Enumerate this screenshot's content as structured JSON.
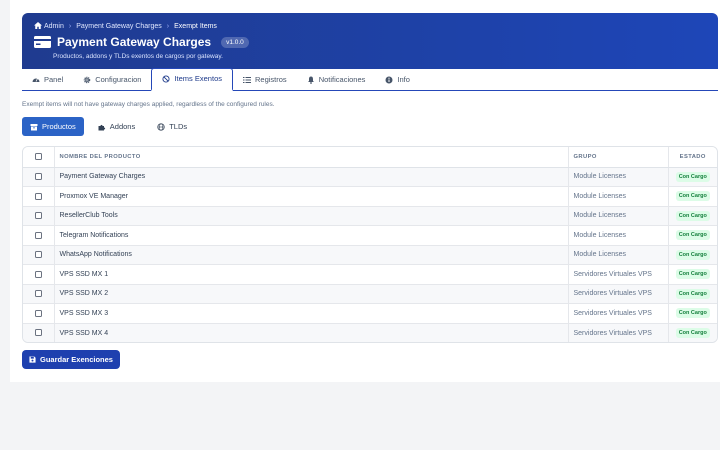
{
  "breadcrumb": {
    "home": "Admin",
    "parent": "Payment Gateway Charges",
    "current": "Exempt Items"
  },
  "header": {
    "title": "Payment Gateway Charges",
    "version": "v1.0.0",
    "subtitle": "Productos, addons y TLDs exentos de cargos por gateway."
  },
  "tabs": [
    {
      "label": "Panel",
      "icon": "gauge-icon"
    },
    {
      "label": "Configuracion",
      "icon": "gear-icon"
    },
    {
      "label": "Items Exentos",
      "icon": "ban-icon",
      "active": true
    },
    {
      "label": "Registros",
      "icon": "list-icon"
    },
    {
      "label": "Notificaciones",
      "icon": "bell-icon"
    },
    {
      "label": "Info",
      "icon": "info-icon"
    }
  ],
  "notice": "Exempt items will not have gateway charges applied, regardless of the configured rules.",
  "pills": [
    {
      "label": "Productos",
      "icon": "box-icon",
      "active": true
    },
    {
      "label": "Addons",
      "icon": "puzzle-icon"
    },
    {
      "label": "TLDs",
      "icon": "globe-icon"
    }
  ],
  "table": {
    "headers": {
      "name": "NOMBRE DEL PRODUCTO",
      "group": "GRUPO",
      "status": "ESTADO"
    },
    "rows": [
      {
        "name": "Payment Gateway Charges",
        "group": "Module Licenses",
        "status": "Con Cargo"
      },
      {
        "name": "Proxmox VE Manager",
        "group": "Module Licenses",
        "status": "Con Cargo"
      },
      {
        "name": "ResellerClub Tools",
        "group": "Module Licenses",
        "status": "Con Cargo"
      },
      {
        "name": "Telegram Notifications",
        "group": "Module Licenses",
        "status": "Con Cargo"
      },
      {
        "name": "WhatsApp Notifications",
        "group": "Module Licenses",
        "status": "Con Cargo"
      },
      {
        "name": "VPS SSD MX 1",
        "group": "Servidores Virtuales VPS",
        "status": "Con Cargo"
      },
      {
        "name": "VPS SSD MX 2",
        "group": "Servidores Virtuales VPS",
        "status": "Con Cargo"
      },
      {
        "name": "VPS SSD MX 3",
        "group": "Servidores Virtuales VPS",
        "status": "Con Cargo"
      },
      {
        "name": "VPS SSD MX 4",
        "group": "Servidores Virtuales VPS",
        "status": "Con Cargo"
      }
    ]
  },
  "save_label": "Guardar Exenciones",
  "colors": {
    "header_start": "#1f3b8f",
    "header_end": "#1e46b8",
    "accent": "#2548b8",
    "primary_button": "#1e40af",
    "success_text": "#15803d",
    "success_bg": "#dcfce7"
  }
}
